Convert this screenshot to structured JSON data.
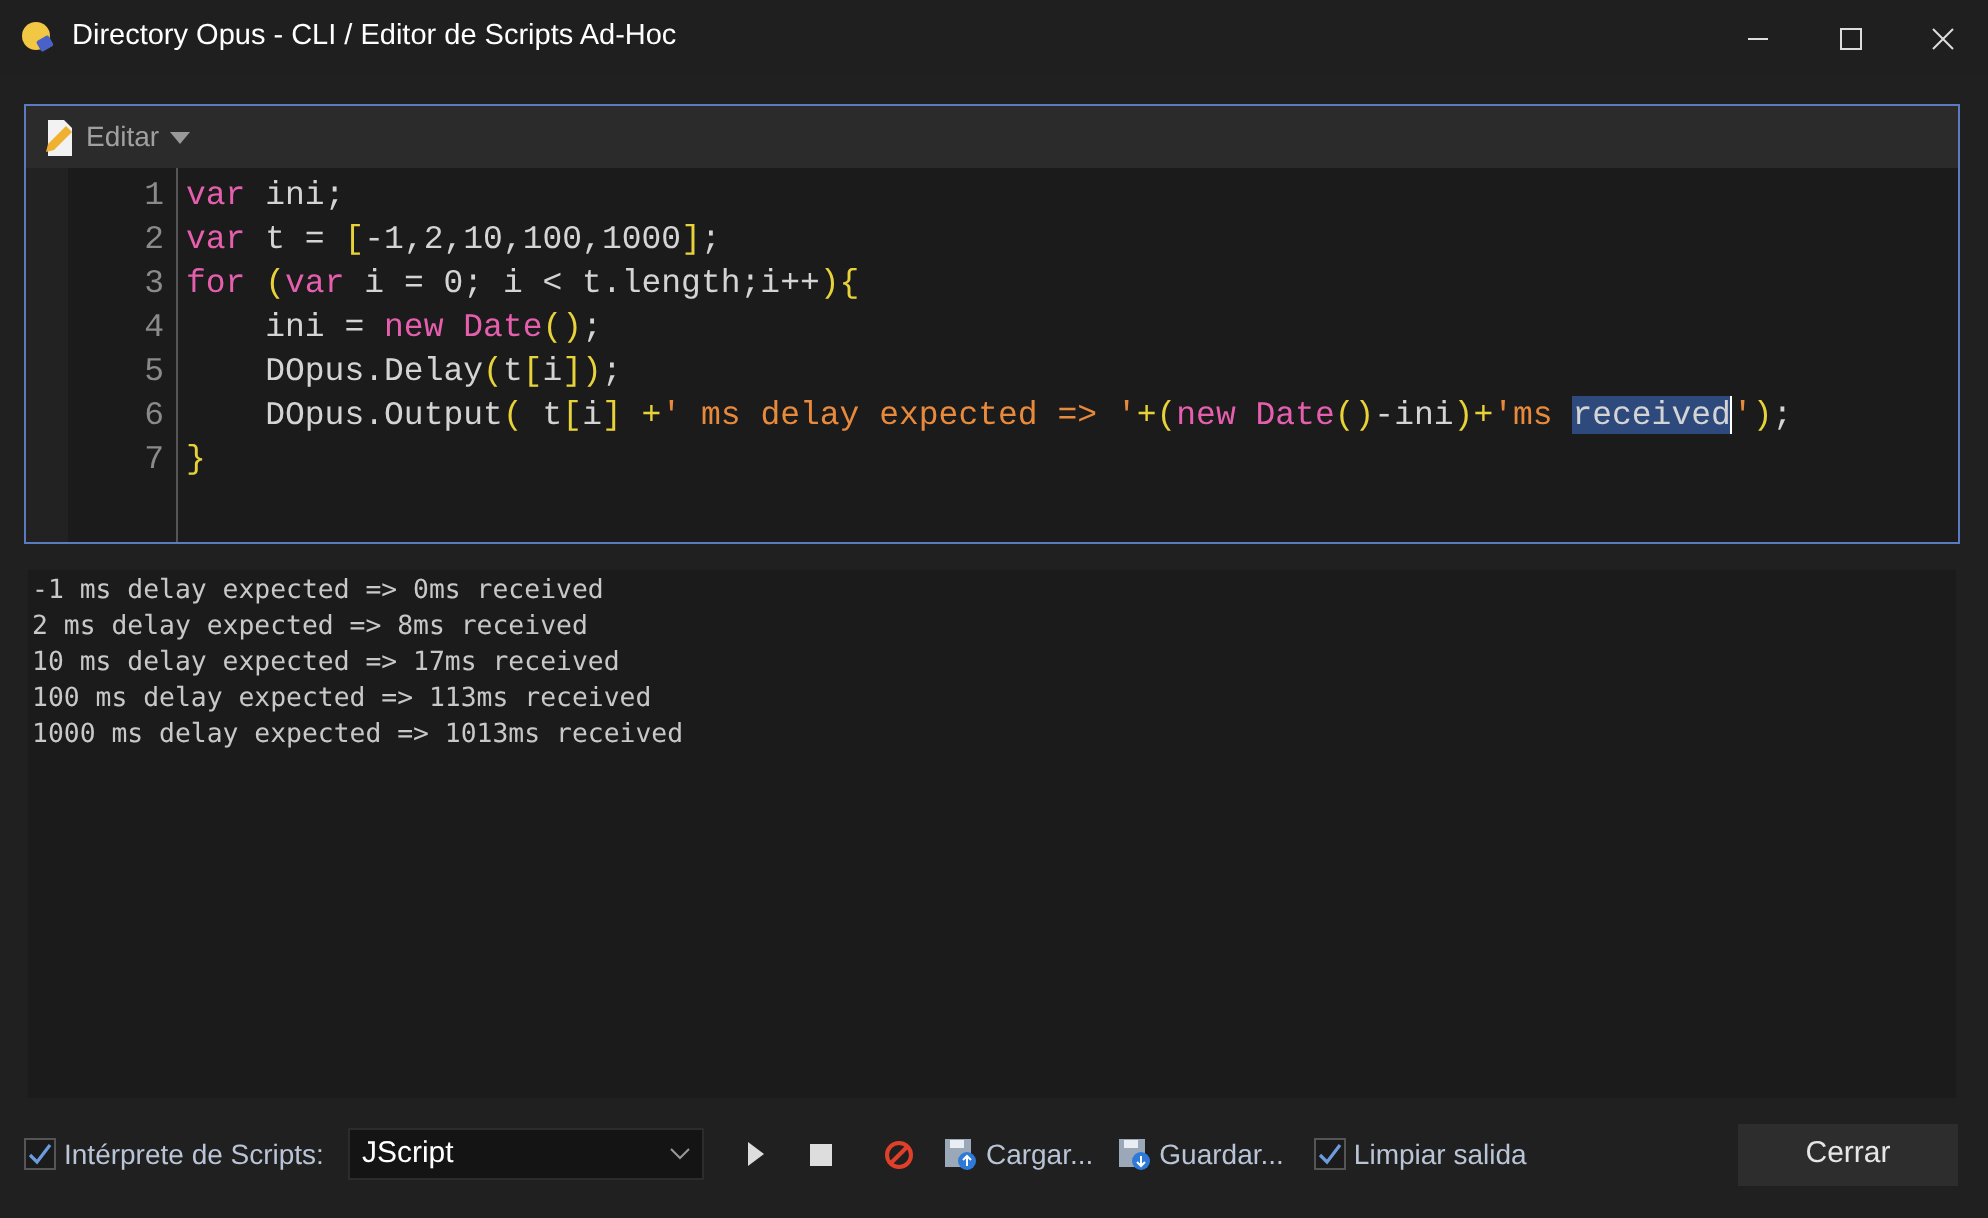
{
  "window": {
    "title": "Directory Opus - CLI / Editor de Scripts Ad-Hoc"
  },
  "toolbar": {
    "menu_label": "Editar"
  },
  "editor": {
    "lines": [
      {
        "number": "1",
        "tokens": [
          {
            "text": "var",
            "kind": "keyword"
          },
          {
            "text": " ini;",
            "kind": "plain"
          }
        ]
      },
      {
        "number": "2",
        "tokens": [
          {
            "text": "var",
            "kind": "keyword"
          },
          {
            "text": " t = ",
            "kind": "plain"
          },
          {
            "text": "[",
            "kind": "bracket"
          },
          {
            "text": "-1,2,10,100,1000",
            "kind": "plain"
          },
          {
            "text": "]",
            "kind": "bracket"
          },
          {
            "text": ";",
            "kind": "plain"
          }
        ]
      },
      {
        "number": "3",
        "tokens": [
          {
            "text": "for ",
            "kind": "keyword"
          },
          {
            "text": "(",
            "kind": "bracket"
          },
          {
            "text": "var",
            "kind": "keyword"
          },
          {
            "text": " i = 0; i < t.length;i++",
            "kind": "plain"
          },
          {
            "text": "){",
            "kind": "bracket"
          }
        ]
      },
      {
        "number": "4",
        "tokens": [
          {
            "text": "    ini = ",
            "kind": "plain"
          },
          {
            "text": "new Date",
            "kind": "keyword"
          },
          {
            "text": "()",
            "kind": "bracket"
          },
          {
            "text": ";",
            "kind": "plain"
          }
        ]
      },
      {
        "number": "5",
        "tokens": [
          {
            "text": "    DOpus.Delay",
            "kind": "plain"
          },
          {
            "text": "(",
            "kind": "bracket"
          },
          {
            "text": "t",
            "kind": "plain"
          },
          {
            "text": "[",
            "kind": "bracket"
          },
          {
            "text": "i",
            "kind": "plain"
          },
          {
            "text": "])",
            "kind": "bracket"
          },
          {
            "text": ";",
            "kind": "plain"
          }
        ]
      },
      {
        "number": "6",
        "tokens": [
          {
            "text": "    DOpus.Output",
            "kind": "plain"
          },
          {
            "text": "(",
            "kind": "bracket"
          },
          {
            "text": " t",
            "kind": "plain"
          },
          {
            "text": "[",
            "kind": "bracket"
          },
          {
            "text": "i",
            "kind": "plain"
          },
          {
            "text": "] +",
            "kind": "bracket"
          },
          {
            "text": "' ms delay expected => '",
            "kind": "string"
          },
          {
            "text": "+",
            "kind": "bracket"
          },
          {
            "text": "(",
            "kind": "bracket"
          },
          {
            "text": "new Date",
            "kind": "keyword"
          },
          {
            "text": "()",
            "kind": "bracket"
          },
          {
            "text": "-ini",
            "kind": "plain"
          },
          {
            "text": ")",
            "kind": "bracket"
          },
          {
            "text": "+",
            "kind": "bracket"
          },
          {
            "text": "'ms ",
            "kind": "string"
          },
          {
            "text": "received",
            "kind": "selection"
          },
          {
            "text": "'",
            "kind": "string"
          },
          {
            "text": ")",
            "kind": "bracket"
          },
          {
            "text": ";",
            "kind": "plain"
          }
        ]
      },
      {
        "number": "7",
        "tokens": [
          {
            "text": "}",
            "kind": "bracket"
          }
        ]
      }
    ]
  },
  "output": {
    "lines": [
      "-1 ms delay expected => 0ms received",
      "2 ms delay expected => 8ms received",
      "10 ms delay expected => 17ms received",
      "100 ms delay expected => 113ms received",
      "1000 ms delay expected => 1013ms received"
    ]
  },
  "footer": {
    "interpreter": {
      "label": "Intérprete de Scripts:",
      "checked": true
    },
    "engine": {
      "value": "JScript"
    },
    "actions": [
      {
        "kind": "play"
      },
      {
        "kind": "stop"
      },
      {
        "kind": "abort"
      },
      {
        "kind": "load",
        "label": "Cargar..."
      },
      {
        "kind": "save",
        "label": "Guardar..."
      }
    ],
    "clear_output": {
      "label": "Limpiar salida",
      "checked": true
    },
    "close_button": "Cerrar"
  }
}
